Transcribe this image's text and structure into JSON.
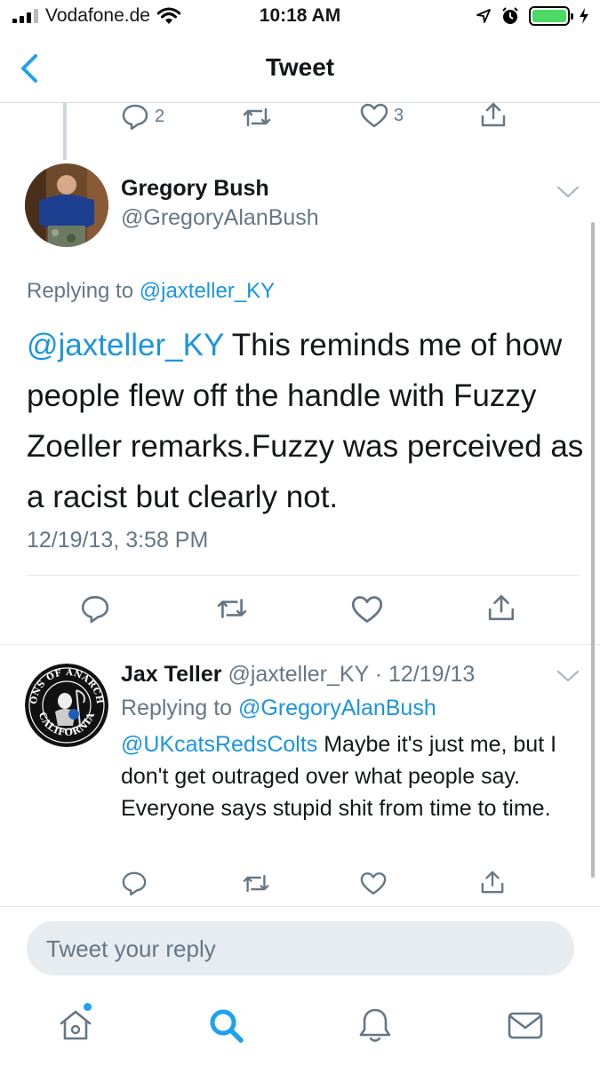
{
  "status_bar": {
    "carrier": "Vodafone.de",
    "time": "10:18 AM"
  },
  "nav": {
    "title": "Tweet"
  },
  "previous_tweet_actions": {
    "reply_count": "2",
    "like_count": "3"
  },
  "main_tweet": {
    "display_name": "Gregory Bush",
    "handle": "@GregoryAlanBush",
    "replying_prefix": "Replying to",
    "replying_to": "@jaxteller_KY",
    "mention": "@jaxteller_KY",
    "body": " This reminds me of how people flew off the handle with Fuzzy Zoeller remarks.Fuzzy was perceived as a racist but clearly not.",
    "timestamp": "12/19/13, 3:58 PM"
  },
  "reply_tweet": {
    "display_name": "Jax Teller",
    "handle_and_date": " @jaxteller_KY · 12/19/13",
    "replying_prefix": "Replying to",
    "replying_to": "@GregoryAlanBush",
    "mention": "@UKcatsRedsColts",
    "body": " Maybe it's just me, but I don't get outraged over what people say. Everyone says stupid shit from time to time.",
    "avatar_top_text": "SONS OF ANARCHY",
    "avatar_bottom_text": "CALIFORNIA"
  },
  "composer": {
    "placeholder": "Tweet your reply"
  },
  "tab_bar": {
    "items": [
      "home-icon",
      "search-icon",
      "notifications-icon",
      "messages-icon"
    ],
    "active": "search-icon"
  },
  "colors": {
    "accent": "#1da1f2",
    "link": "#1b95e0",
    "secondary_text": "#657786",
    "battery": "#4cd964"
  }
}
